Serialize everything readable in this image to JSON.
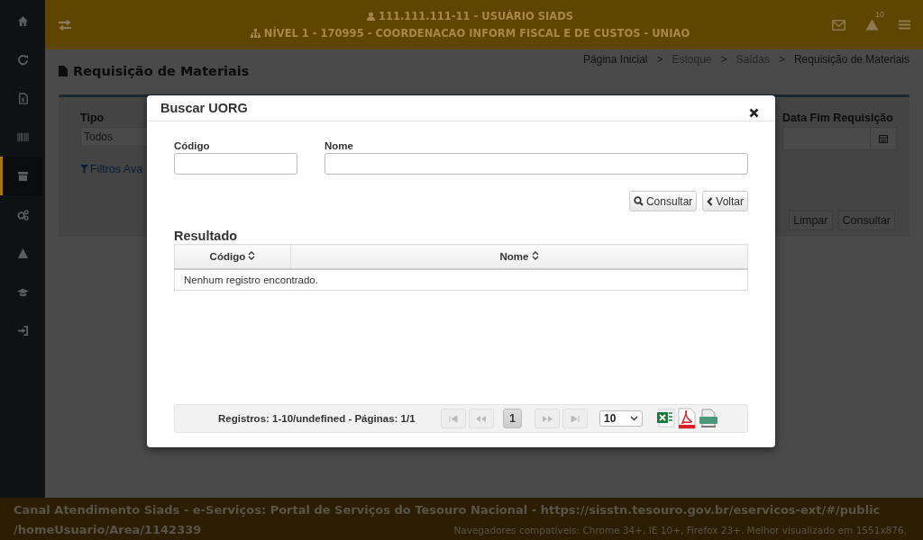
{
  "sidebar": {
    "items": [
      {
        "selected": false
      },
      {
        "selected": false
      },
      {
        "selected": false
      },
      {
        "selected": false
      },
      {
        "selected": true
      },
      {
        "selected": false
      },
      {
        "selected": false
      },
      {
        "selected": false
      },
      {
        "selected": false
      }
    ]
  },
  "header": {
    "user": "111.111.111-11 - USUÁRIO SIADS",
    "level": "NÍVEL 1 - 170995 - COORDENACAO INFORM FISCAL E DE CUSTOS - UNIAO",
    "alert_count": "10"
  },
  "page": {
    "title": "Requisição de Materiais",
    "breadcrumb_separator": ">",
    "breadcrumbs": [
      {
        "label": "Página Inicial",
        "disabled": false
      },
      {
        "label": "Estoque",
        "disabled": true
      },
      {
        "label": "Saídas",
        "disabled": true
      },
      {
        "label": "Requisição de Materiais",
        "disabled": false
      }
    ],
    "filters": {
      "tipo_label": "Tipo",
      "tipo_value": "Todos",
      "advanced_link": "Filtros Ava",
      "date_end_label": "Data Fim Requisição",
      "buttons": [
        "Limpar",
        "Consultar"
      ]
    }
  },
  "modal": {
    "title": "Buscar UORG",
    "fields": [
      {
        "label": "Código"
      },
      {
        "label": "Nome"
      }
    ],
    "buttons": [
      "Consultar",
      "Voltar"
    ],
    "result_title": "Resultado",
    "table": {
      "columns": [
        "Código",
        "Nome"
      ],
      "empty_message": "Nenhum registro encontrado."
    },
    "pagination": {
      "summary": "Registros: 1-10/undefined - Páginas: 1/1",
      "pages": [
        {
          "label": "1",
          "selected": true
        }
      ],
      "page_size": "10"
    }
  },
  "footer": {
    "text": "Canal Atendimento Siads - e-Serviços: Portal de Serviços do Tesouro Nacional - https://sisstn.tesouro.gov.br/eservicos-ext/#/public",
    "text_continued": "/homeUsuario/Area/1142339",
    "compat": "Navegadores compatíveis: Chrome 34+, IE 10+, Firefox 23+. Melhor visualizado em 1551x876."
  }
}
